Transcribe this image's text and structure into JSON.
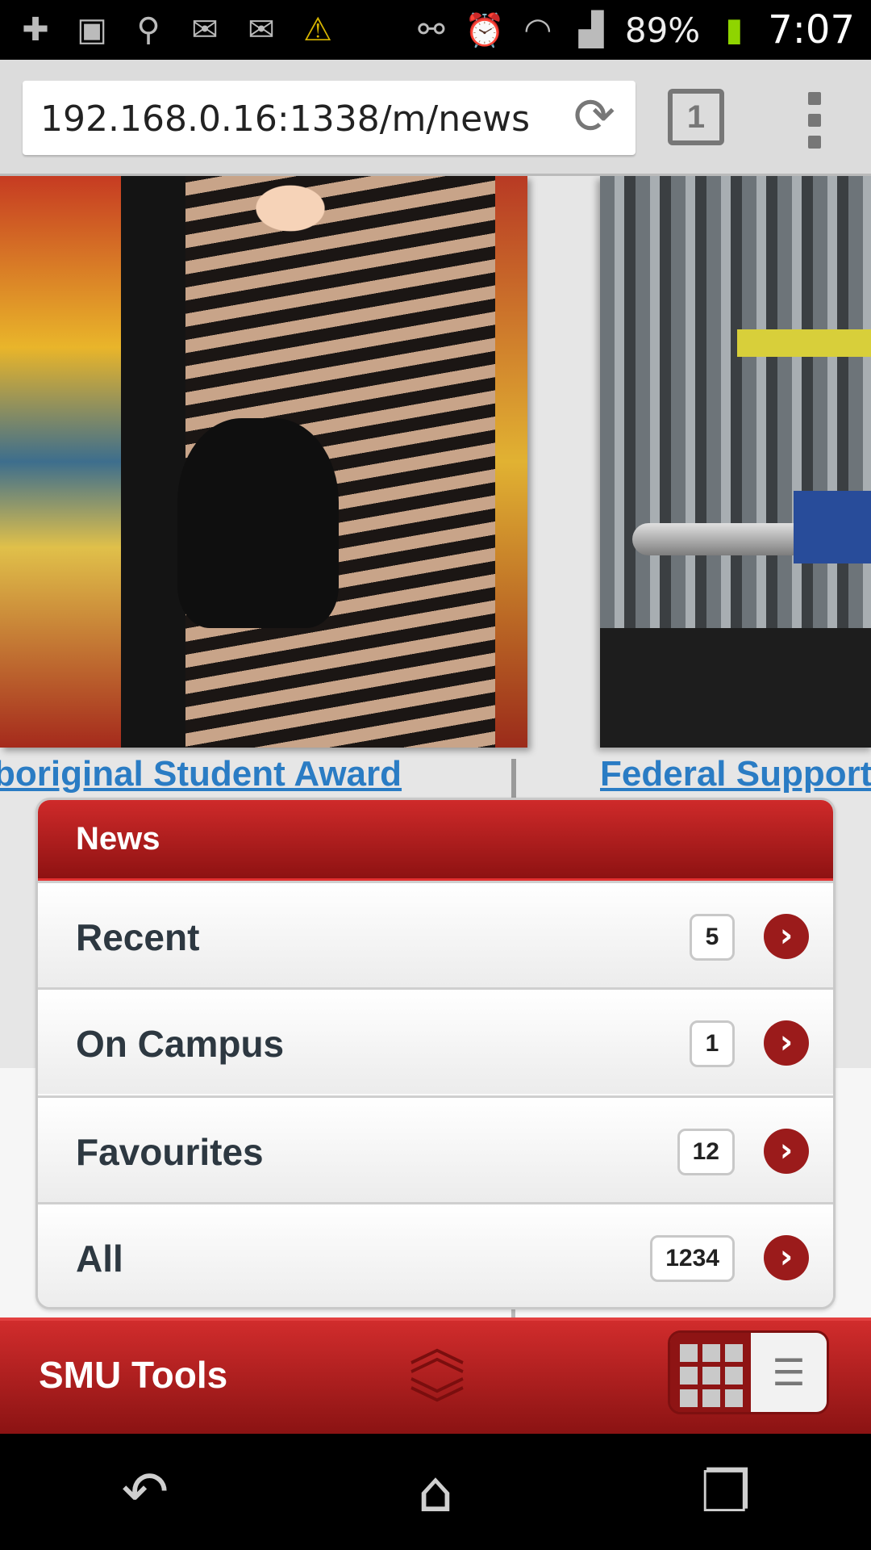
{
  "status_bar": {
    "icons_left": [
      "add-icon",
      "image-icon",
      "voicemail-icon",
      "gmail-icon",
      "mail-icon",
      "warning-icon"
    ],
    "icons_right": [
      "usb-icon",
      "alarm-icon",
      "wifi-icon",
      "signal-icon",
      "battery-icon"
    ],
    "battery": "89%",
    "time": "7:07"
  },
  "browser": {
    "url": "192.168.0.16:1338/m/news",
    "tab_count": "1"
  },
  "carousel": {
    "items": [
      {
        "caption": "boriginal Student Award"
      },
      {
        "caption": "Federal Support"
      }
    ]
  },
  "news": {
    "title": "News",
    "rows": [
      {
        "label": "Recent",
        "count": "5"
      },
      {
        "label": "On Campus",
        "count": "1"
      },
      {
        "label": "Favourites",
        "count": "12"
      },
      {
        "label": "All",
        "count": "1234"
      }
    ]
  },
  "tools": {
    "title": "SMU Tools"
  },
  "colors": {
    "accent_red": "#b51f1f",
    "link_blue": "#2a7cc4",
    "text_dark": "#2d3841"
  }
}
